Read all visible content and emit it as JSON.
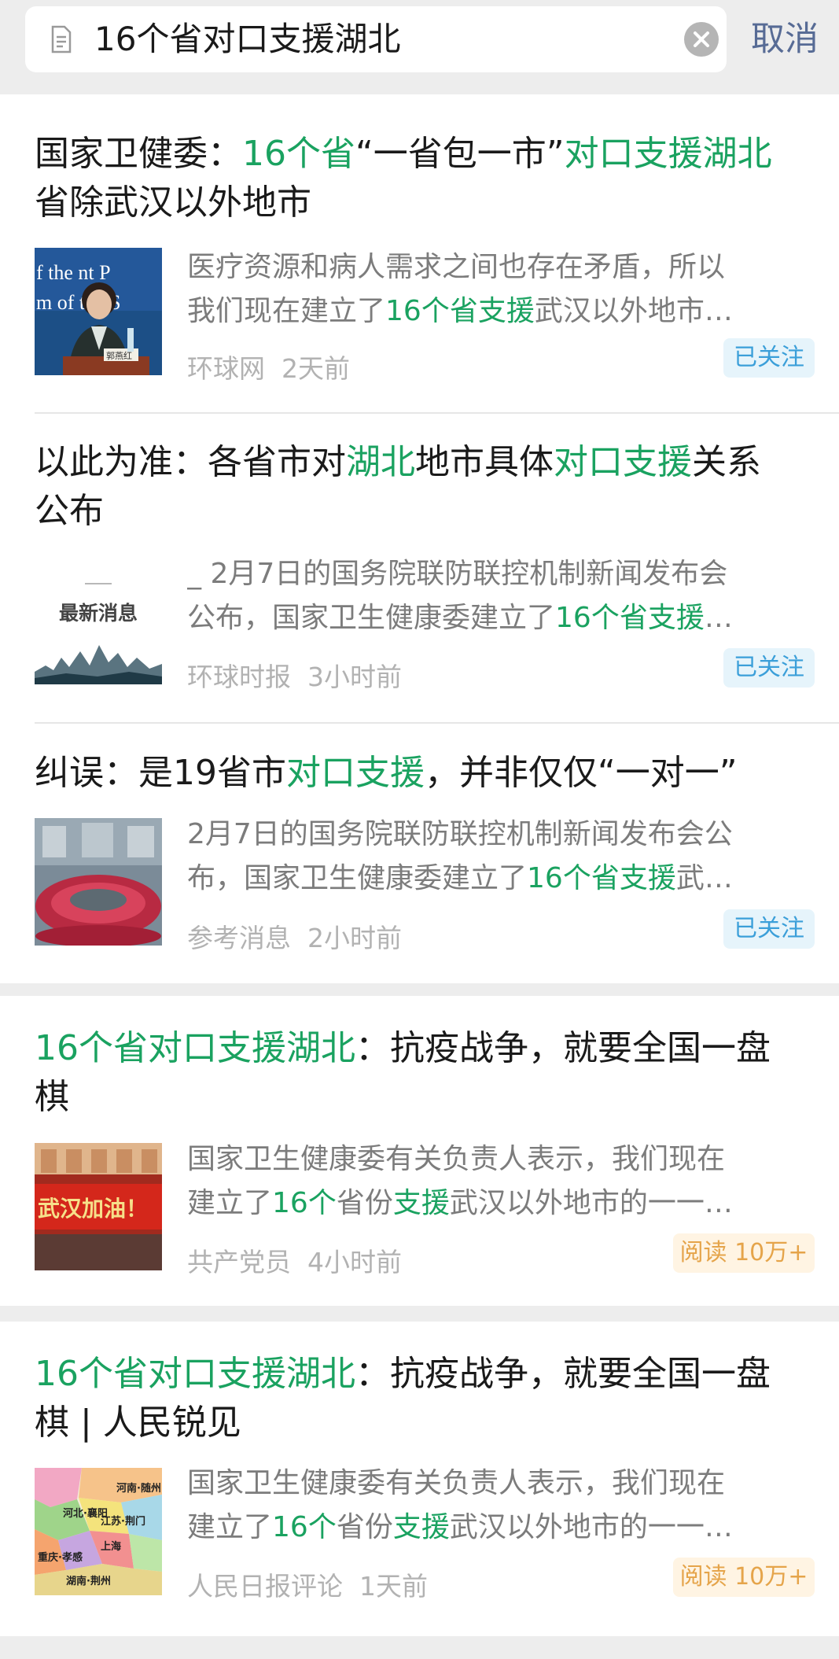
{
  "search": {
    "query": "16个省对口支援湖北",
    "cancel_label": "取消"
  },
  "colors": {
    "highlight": "#1aa260",
    "cancel": "#576b95",
    "follow_badge": "#3b9fd9",
    "read_badge": "#e5a44a"
  },
  "results": [
    {
      "title_parts": [
        "国家卫健委：",
        "16个省",
        "“一省包一市”",
        "对口支援湖北",
        "省除武汉以外地市"
      ],
      "desc_parts": [
        "医疗资源和病人需求之间也存在矛盾，所以",
        "我们现在建立了",
        "16个省支援",
        "武汉以外地市…"
      ],
      "thumb_text": [
        "f the  nt P",
        "m  of the  S",
        "郭燕红"
      ],
      "source": "环球网",
      "time": "2天前",
      "badge": "已关注"
    },
    {
      "title_parts": [
        "以此为准：各省市对",
        "湖北",
        "地市具体",
        "对口支援",
        "关系",
        "公布"
      ],
      "desc_parts": [
        "_ 2月7日的国务院联防联控机制新闻发布会",
        "公布，国家卫生健康委建立了",
        "16个省支援",
        "…"
      ],
      "thumb_text": [
        "最新消息"
      ],
      "source": "环球时报",
      "time": "3小时前",
      "badge": "已关注"
    },
    {
      "title_parts": [
        "纠误：是19省市",
        "对口支援",
        "，并非仅仅“一对一”"
      ],
      "desc_parts": [
        "2月7日的国务院联防联控机制新闻发布会公",
        "布，国家卫生健康委建立了",
        "16个省支援",
        "武…"
      ],
      "source": "参考消息",
      "time": "2小时前",
      "badge": "已关注"
    },
    {
      "title_parts": [
        "16个省对口支援湖北",
        "：抗疫战争，就要全国一盘",
        "棋"
      ],
      "desc_parts": [
        "国家卫生健康委有关负责人表示，我们现在",
        "建立了",
        "16个",
        "省份",
        "支援",
        "武汉以外地市的一一…"
      ],
      "thumb_text": [
        "武汉加油！"
      ],
      "source": "共产党员",
      "time": "4小时前",
      "badge": "阅读 10万+"
    },
    {
      "title_parts": [
        "16个省对口支援湖北",
        "：抗疫战争，就要全国一盘",
        "棋 | 人民锐见"
      ],
      "desc_parts": [
        "国家卫生健康委有关负责人表示，我们现在",
        "建立了",
        "16个",
        "省份",
        "支援",
        "武汉以外地市的一一…"
      ],
      "thumb_text": [
        "河北·襄阳",
        "河南·随州",
        "江苏·荆门",
        "上海",
        "重庆·孝感",
        "湖南·荆州"
      ],
      "source": "人民日报评论",
      "time": "1天前",
      "badge": "阅读 10万+"
    }
  ]
}
